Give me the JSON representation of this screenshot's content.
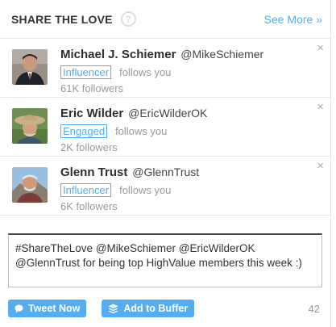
{
  "header": {
    "title": "SHARE THE LOVE",
    "help_glyph": "?",
    "see_more": "See More »"
  },
  "users": [
    {
      "name": "Michael J. Schiemer",
      "handle": "@MikeSchiemer",
      "badge": "Influencer",
      "follows": "follows you",
      "followers": "61K followers",
      "close": "×"
    },
    {
      "name": "Eric Wilder",
      "handle": "@EricWilderOK",
      "badge": "Engaged",
      "follows": "follows you",
      "followers": "2K followers",
      "close": "×"
    },
    {
      "name": "Glenn Trust",
      "handle": "@GlennTrust",
      "badge": "Influencer",
      "follows": "follows you",
      "followers": "6K followers",
      "close": "×"
    }
  ],
  "composer": {
    "text": "#ShareTheLove @MikeSchiemer @EricWilderOK @GlennTrust for being top HighValue members this week :)"
  },
  "actions": {
    "tweet_label": "Tweet Now",
    "buffer_label": "Add to Buffer",
    "char_count": "42"
  },
  "colors": {
    "accent": "#55acee",
    "muted": "#999999"
  },
  "icons": {
    "tweet": "speech-bubble-icon",
    "buffer": "buffer-layers-icon",
    "close": "close-icon",
    "help": "question-circle-icon"
  }
}
